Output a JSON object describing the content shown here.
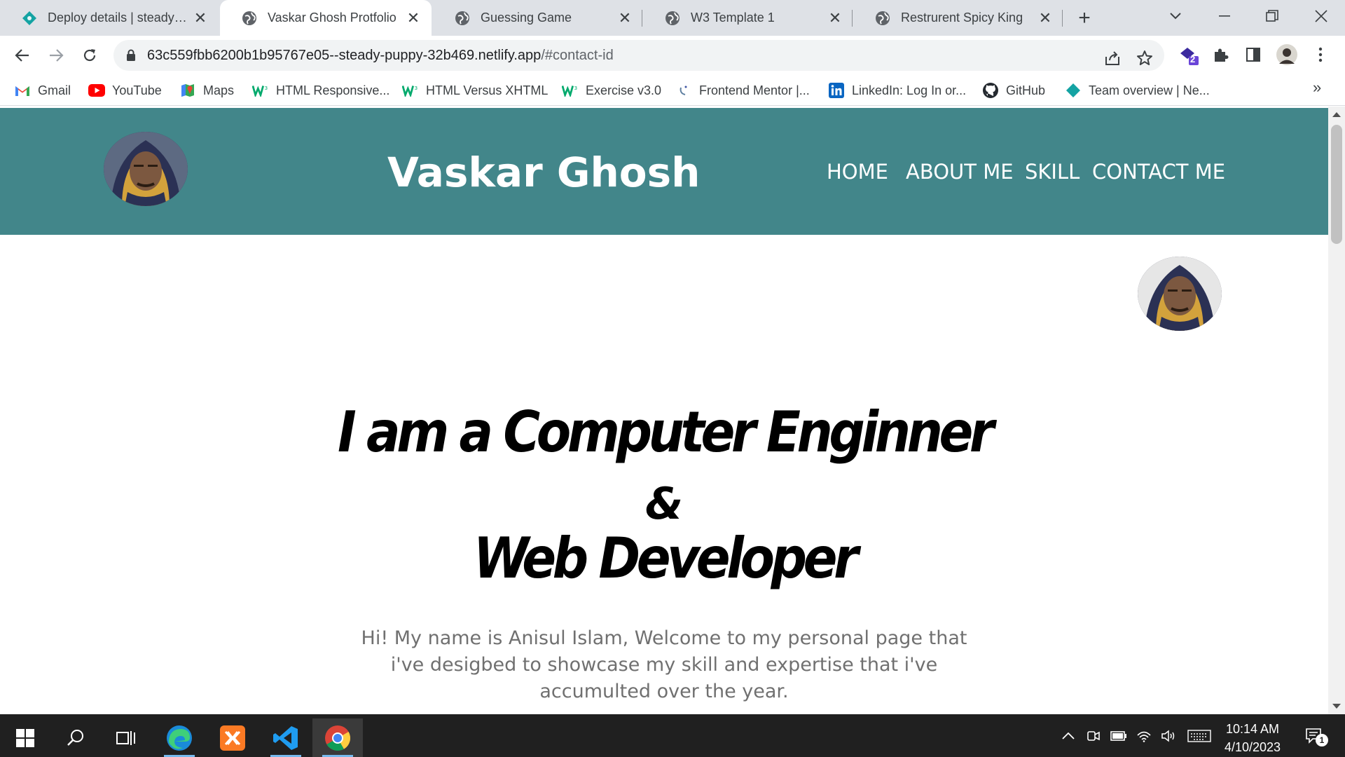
{
  "browser": {
    "tabs": [
      {
        "title": "Deploy details | steady-pu",
        "icon": "netlify-icon",
        "active": false
      },
      {
        "title": "Vaskar Ghosh Protfolio",
        "icon": "globe-icon",
        "active": true
      },
      {
        "title": "Guessing Game",
        "icon": "globe-icon",
        "active": false
      },
      {
        "title": "W3 Template 1",
        "icon": "globe-icon",
        "active": false
      },
      {
        "title": "Restrurent Spicy King",
        "icon": "globe-icon",
        "active": false
      }
    ],
    "close_glyph": "✕",
    "new_tab_glyph": "+",
    "url_host": "63c559fbb6200b1b95767e05--steady-puppy-32b469.netlify.app",
    "url_path": "/#contact-id",
    "extension_badge": "2",
    "bookmarks": [
      {
        "label": "Gmail",
        "icon": "gmail-icon"
      },
      {
        "label": "YouTube",
        "icon": "youtube-icon"
      },
      {
        "label": "Maps",
        "icon": "maps-icon"
      },
      {
        "label": "HTML Responsive...",
        "icon": "w3schools-icon"
      },
      {
        "label": "HTML Versus XHTML",
        "icon": "w3schools-icon"
      },
      {
        "label": "Exercise v3.0",
        "icon": "w3schools-icon"
      },
      {
        "label": "Frontend Mentor |...",
        "icon": "frontend-mentor-icon"
      },
      {
        "label": "LinkedIn: Log In or...",
        "icon": "linkedin-icon"
      },
      {
        "label": "GitHub",
        "icon": "github-icon"
      },
      {
        "label": "Team overview | Ne...",
        "icon": "netlify-icon"
      }
    ],
    "bookmarks_more": "»"
  },
  "site": {
    "header_color": "#42868a",
    "name": "Vaskar Ghosh",
    "nav": [
      "HOME",
      "ABOUT ME",
      "SKILL",
      "CONTACT ME"
    ],
    "hero_line1": "I am a Computer Enginner",
    "hero_amp": "&",
    "hero_line2": "Web Developer",
    "intro": "Hi! My name is Anisul Islam, Welcome to my personal page that i've desigbed to showcase my skill and expertise that i've accumulted over the year."
  },
  "taskbar": {
    "apps": [
      "start-icon",
      "search-icon",
      "task-view-icon",
      "edge-icon",
      "xampp-icon",
      "vscode-icon",
      "chrome-icon"
    ],
    "time": "10:14 AM",
    "date": "4/10/2023",
    "notification_count": "1"
  }
}
